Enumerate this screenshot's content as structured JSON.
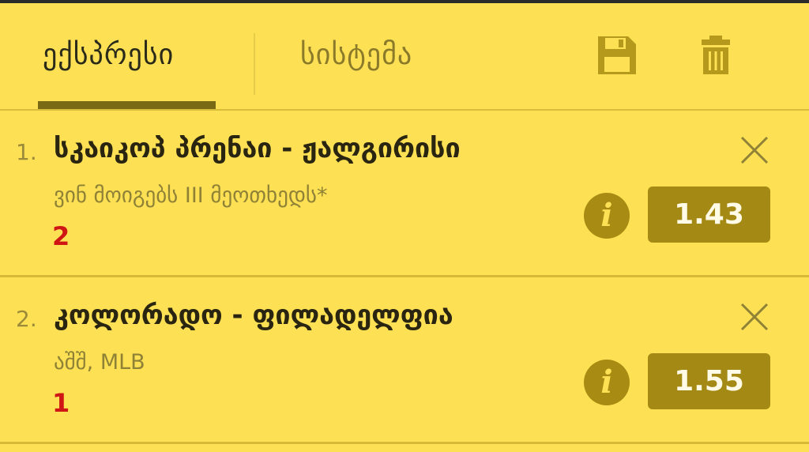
{
  "tabs": {
    "express": "ექსპრესი",
    "system": "სისტემა"
  },
  "toolbar": {
    "save_icon": "save-icon",
    "trash_icon": "trash-icon"
  },
  "colors": {
    "background": "#fde053",
    "accent": "#a48a14",
    "pick": "#d01515"
  },
  "bets": [
    {
      "index": "1.",
      "match": "სკაიკოპ პრენაი - ჟალგირისი",
      "market": "ვინ მოიგებს III მეოთხედს*",
      "pick": "2",
      "odds": "1.43"
    },
    {
      "index": "2.",
      "match": "კოლორადო - ფილადელფია",
      "market": "აშშ, MLB",
      "pick": "1",
      "odds": "1.55"
    }
  ]
}
